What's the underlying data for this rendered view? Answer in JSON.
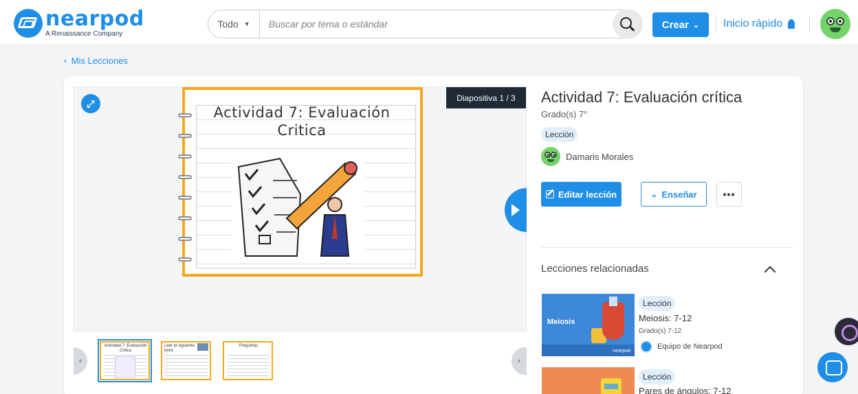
{
  "brand": {
    "name": "nearpod",
    "tagline": "A Renaissance Company",
    "color": "#1e8ee6"
  },
  "header": {
    "search": {
      "filter": "Todo",
      "placeholder": "Buscar por tema o estándar"
    },
    "create_label": "Crear",
    "quick_start_label": "Inicio rápido"
  },
  "breadcrumb": {
    "back_label": "Mis Lecciones"
  },
  "preview": {
    "slide_counter": "Diapositiva 1 / 3",
    "slide_title": "Actividad 7: Evaluación Critica",
    "thumbnails": [
      {
        "title": "Actividad 7: Evaluación Critica"
      },
      {
        "title": "Leer el siguiente texto"
      },
      {
        "title": "Preguntas"
      }
    ]
  },
  "lesson": {
    "title": "Actividad 7: Evaluación crítica",
    "grade": "Grado(s) 7°",
    "type_badge": "Lección",
    "author": "Damaris Morales",
    "edit_label": "Editar lección",
    "teach_label": "Enseñar",
    "more_label": "•••"
  },
  "related": {
    "heading": "Lecciones relacionadas",
    "items": [
      {
        "badge": "Lección",
        "name": "Meiosis: 7-12",
        "grade": "Grado(s) 7-12",
        "author": "Equipo de Nearpod",
        "thumb_text": "Meiosis",
        "thumb_brand": "nearpod"
      },
      {
        "badge": "Lección",
        "name": "Pares de ángulos: 7-12"
      }
    ]
  }
}
